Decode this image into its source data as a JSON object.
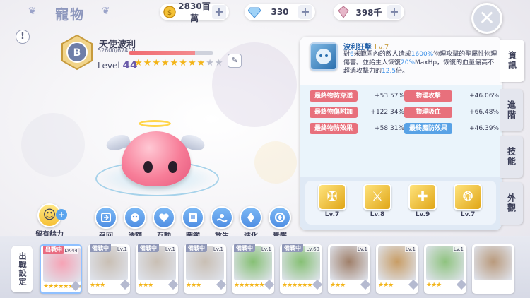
{
  "header": {
    "title": "寵物"
  },
  "resources": [
    {
      "icon": "gold-coin-icon",
      "value": "2830百萬"
    },
    {
      "icon": "diamond-icon",
      "value": "330"
    },
    {
      "icon": "crystal-icon",
      "value": "398千"
    }
  ],
  "pet": {
    "name": "天使波利",
    "rank": "B",
    "hp_text": "52600/67400",
    "hp_fraction": 0.78,
    "level_label": "Level",
    "level": "44",
    "stars_on": 8,
    "stars_total": 10
  },
  "actions": [
    {
      "label": "召回",
      "icon": "recall-icon"
    },
    {
      "label": "洗額",
      "icon": "wash-icon"
    },
    {
      "label": "互動",
      "icon": "heart-icon"
    },
    {
      "label": "圖鑑",
      "icon": "book-icon"
    },
    {
      "label": "放生",
      "icon": "release-icon"
    },
    {
      "label": "進化",
      "icon": "evolve-icon"
    },
    {
      "label": "覺醒",
      "icon": "awaken-icon"
    }
  ],
  "remaining": {
    "label": "留有餘力"
  },
  "skill": {
    "name": "波利狂擊",
    "level": "Lv.7",
    "desc_parts": [
      "對",
      "6",
      "米範圍內的敵人造成",
      "1600%",
      "物理攻擊的聖屬性物理傷害。並給主人恢復",
      "20%",
      "MaxHp，恢復的血量最高不超過攻擊力的",
      "12.5",
      "倍。"
    ]
  },
  "stats_left": [
    {
      "label": "最終物防穿透",
      "value": "+53.57%"
    },
    {
      "label": "最終物傷附加",
      "value": "+122.34%"
    },
    {
      "label": "最終物防效果",
      "value": "+58.31%"
    }
  ],
  "stats_right": [
    {
      "label": "物理攻擊",
      "value": "+46.06%",
      "color": "red"
    },
    {
      "label": "物理吸血",
      "value": "+66.48%",
      "color": "red"
    },
    {
      "label": "最終魔防效果",
      "value": "+46.39%",
      "color": "blue"
    }
  ],
  "bonuses": [
    {
      "level": "Lv.7"
    },
    {
      "level": "Lv.8"
    },
    {
      "level": "Lv.9"
    },
    {
      "level": "Lv.7"
    }
  ],
  "tabs": [
    "資訊",
    "進階",
    "技能",
    "外觀"
  ],
  "deploy_label": "出戰設定",
  "roster": [
    {
      "tag": "出戰中",
      "level": "Lv.44",
      "stars": "★★★★★★★★",
      "color": "#f6a3b5"
    },
    {
      "tag": "備戰中",
      "level": "Lv.1",
      "stars": "★★★",
      "color": "#c9bfb4"
    },
    {
      "tag": "備戰中",
      "level": "Lv.1",
      "stars": "★★★",
      "color": "#c9bfb4"
    },
    {
      "tag": "備戰中",
      "level": "Lv.1",
      "stars": "★★★",
      "color": "#c9bfb4"
    },
    {
      "tag": "備戰中",
      "level": "Lv.1",
      "stars": "★★★★★★",
      "color": "#86c074"
    },
    {
      "tag": "備戰中",
      "level": "Lv.60",
      "stars": "★★★★★★",
      "color": "#86c074"
    },
    {
      "tag": "",
      "level": "Lv.1",
      "stars": "★★★",
      "color": "#a0806a"
    },
    {
      "tag": "",
      "level": "Lv.1",
      "stars": "★★★",
      "color": "#c89d65"
    },
    {
      "tag": "",
      "level": "Lv.1",
      "stars": "★★★",
      "color": "#8fc37f"
    },
    {
      "tag": "",
      "level": "",
      "stars": "",
      "color": "#b99a7c"
    }
  ],
  "colors": {
    "accent": "#5aa4ee",
    "hp": "#f06a6f",
    "gold": "#f3b417"
  }
}
